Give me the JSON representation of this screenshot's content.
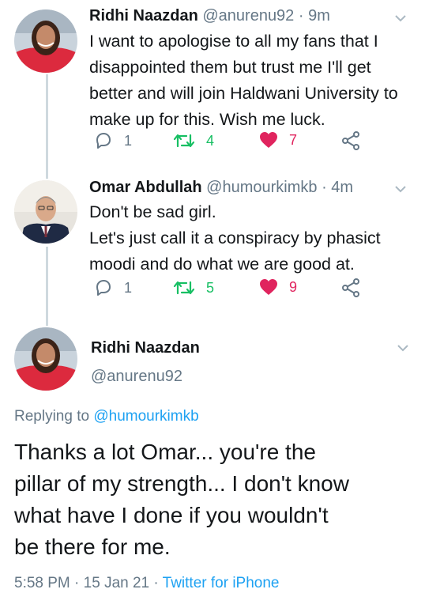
{
  "tweets": [
    {
      "name": "Ridhi Naazdan",
      "handle": "@anurenu92",
      "time": "· 9m",
      "lines": [
        "I want to apologise to all my fans that I",
        "disappointed them but trust me I'll get",
        "better and will join Haldwani University to",
        "make up for this. Wish me luck."
      ],
      "replies": "1",
      "retweets": "4",
      "likes": "7"
    },
    {
      "name": "Omar Abdullah",
      "handle": "@humourkimkb",
      "time": "· 4m",
      "lines": [
        "Don't be sad girl.",
        "Let's just call it a conspiracy by phasict",
        "moodi and do what we are good at."
      ],
      "replies": "1",
      "retweets": "5",
      "likes": "9"
    }
  ],
  "main": {
    "name": "Ridhi Naazdan",
    "handle": "@anurenu92",
    "replying_prefix": "Replying to",
    "replying_handle": "@humourkimkb",
    "lines": [
      "Thanks a lot Omar... you're the",
      "pillar of my strength... I don't know",
      "what have I done if you wouldn't",
      "be there for me."
    ],
    "time": "5:58 PM",
    "date": "· 15 Jan 21 ·",
    "source": "Twitter for iPhone"
  },
  "colors": {
    "accent": "#1da1f2",
    "retweet": "#17bf63",
    "like": "#e0245e",
    "muted": "#657786"
  },
  "icons": [
    "reply-icon",
    "retweet-icon",
    "heart-icon",
    "share-icon",
    "chevron-down-icon"
  ]
}
